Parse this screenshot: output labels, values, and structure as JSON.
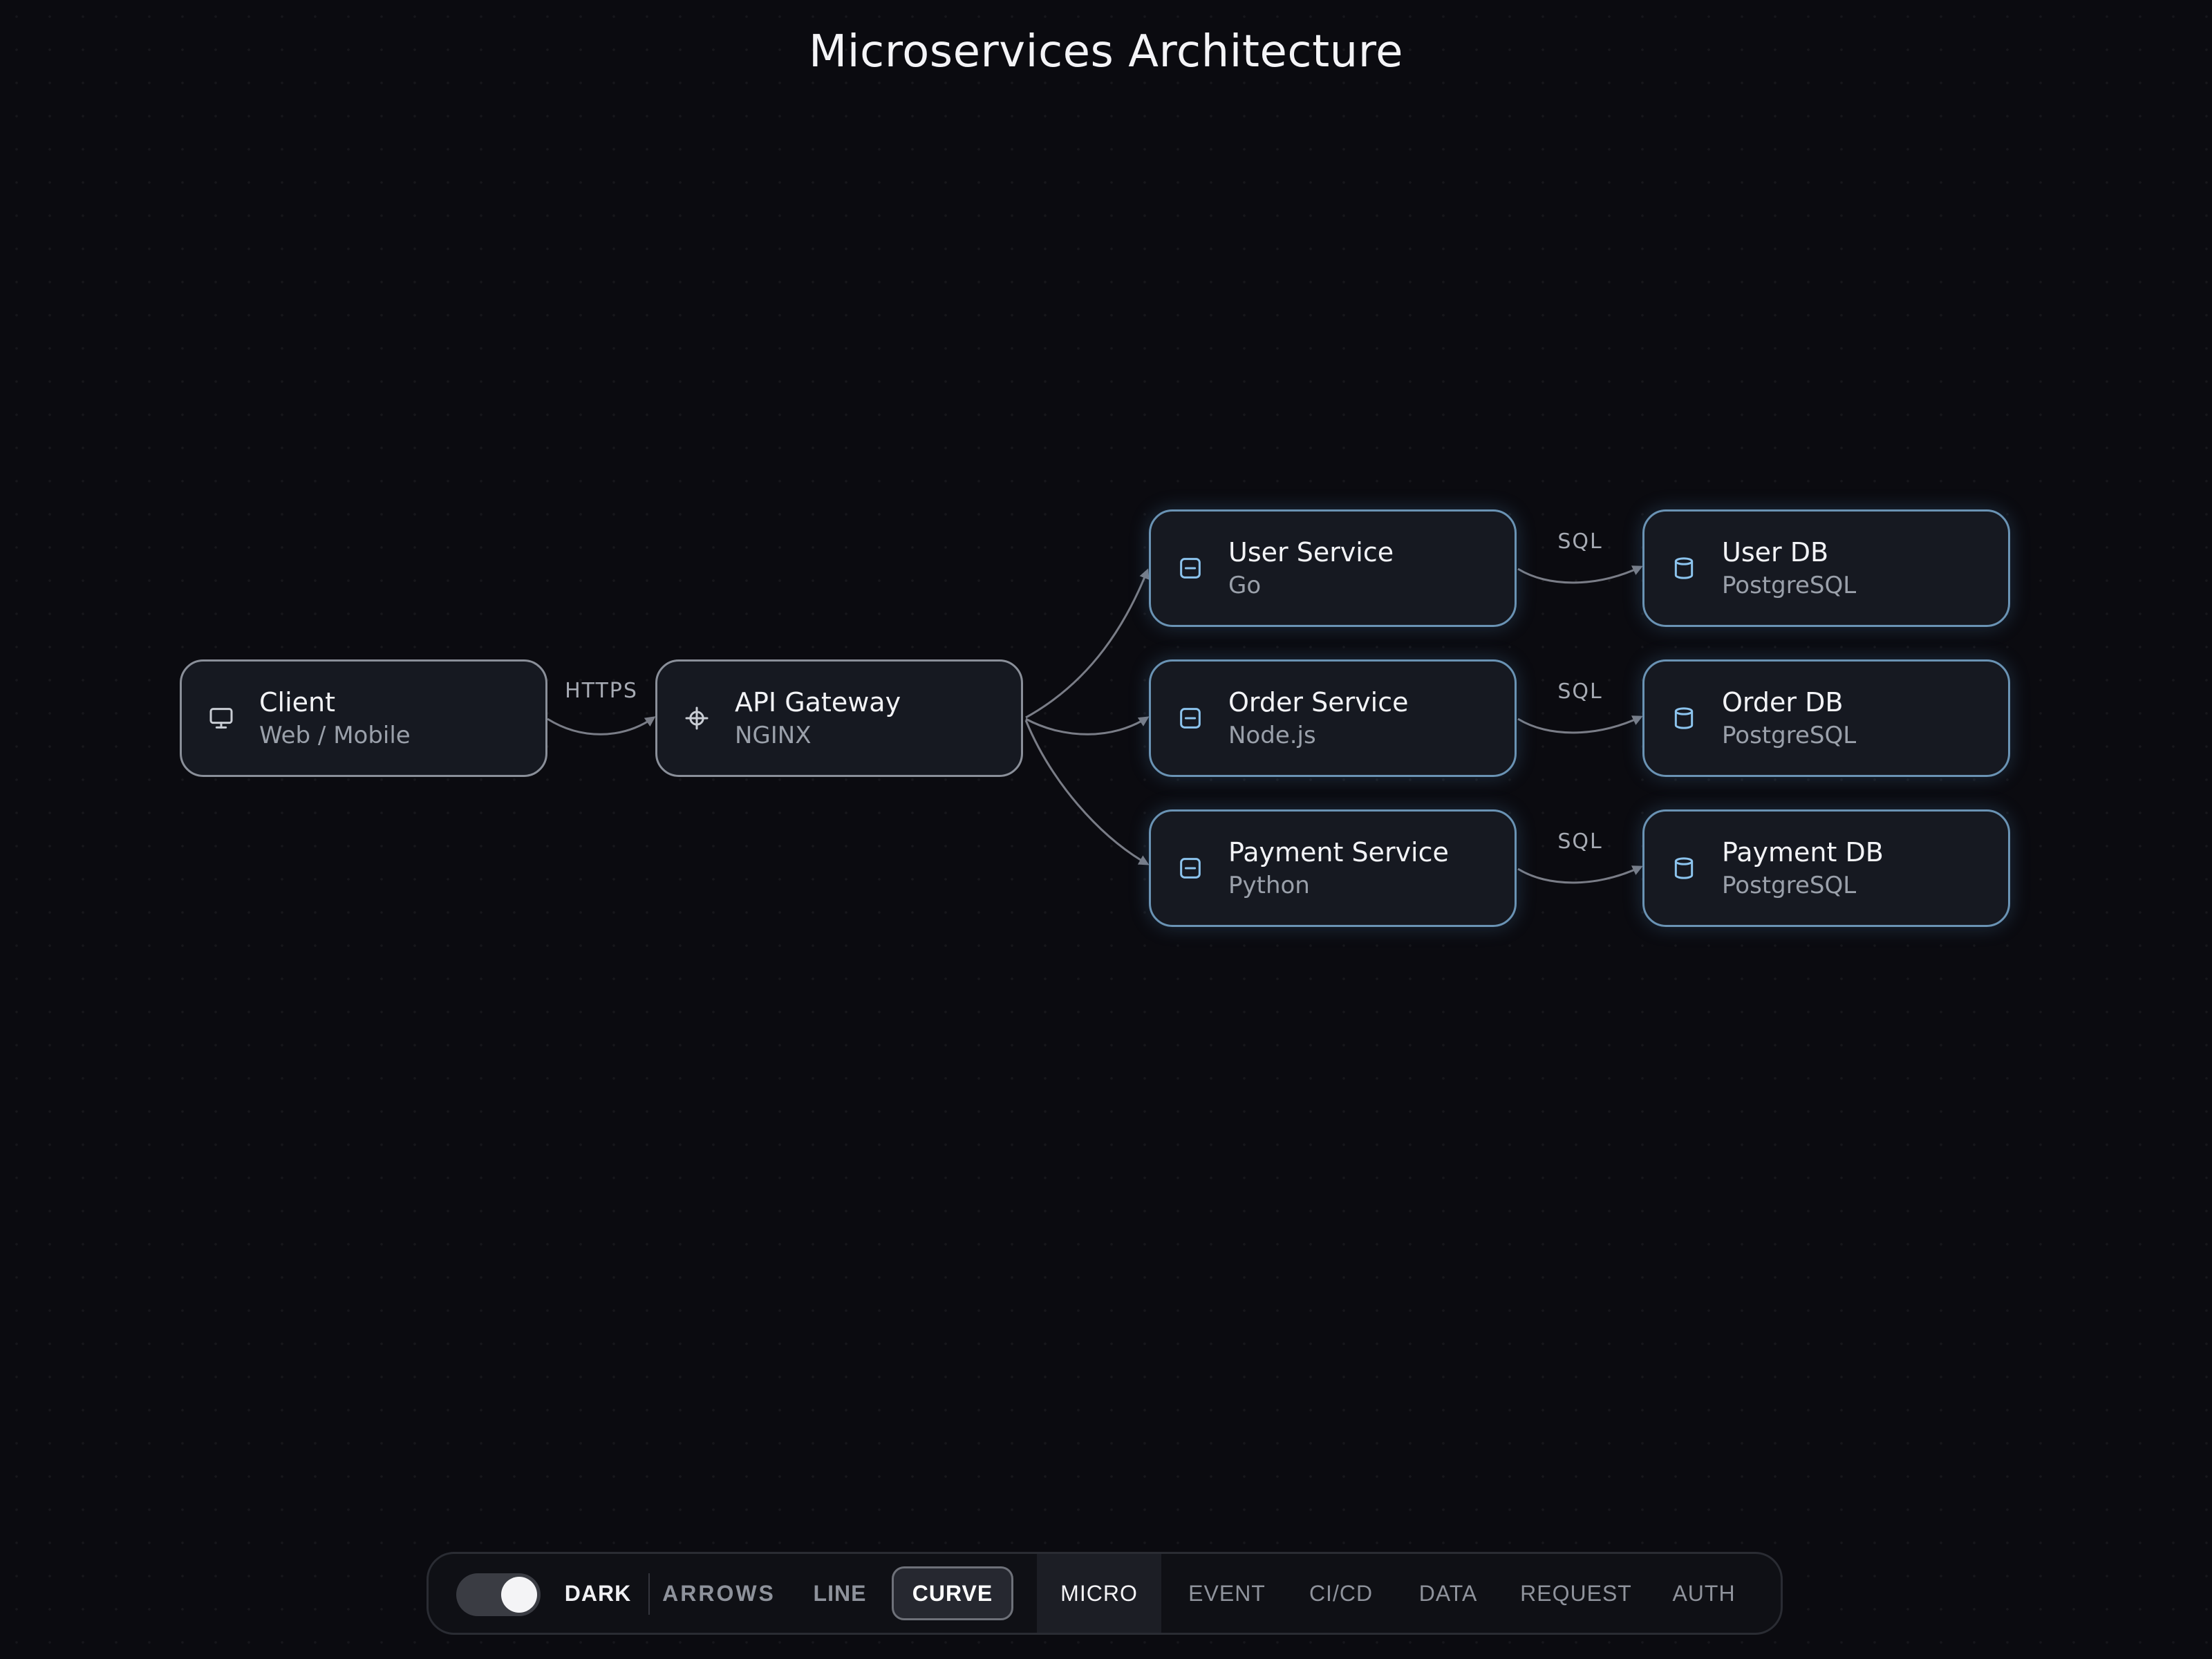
{
  "title": "Microservices Architecture",
  "colors": {
    "background": "#0b0b10",
    "node_fill": "#161921",
    "node_border_plain": "#8a8f99",
    "node_border_accent": "#6a93b4",
    "icon_accent": "#8cc4ee",
    "edge": "#8e929c"
  },
  "nodes": {
    "client": {
      "name": "Client",
      "sub": "Web / Mobile",
      "icon": "monitor-icon"
    },
    "gateway": {
      "name": "API Gateway",
      "sub": "NGINX",
      "icon": "crosshair-icon"
    },
    "user_service": {
      "name": "User Service",
      "sub": "Go",
      "icon": "service-box-icon"
    },
    "order_service": {
      "name": "Order Service",
      "sub": "Node.js",
      "icon": "service-box-icon"
    },
    "payment_service": {
      "name": "Payment Service",
      "sub": "Python",
      "icon": "service-box-icon"
    },
    "user_db": {
      "name": "User DB",
      "sub": "PostgreSQL",
      "icon": "database-icon"
    },
    "order_db": {
      "name": "Order DB",
      "sub": "PostgreSQL",
      "icon": "database-icon"
    },
    "payment_db": {
      "name": "Payment DB",
      "sub": "PostgreSQL",
      "icon": "database-icon"
    }
  },
  "edges": [
    {
      "from": "client",
      "to": "gateway",
      "label": "HTTPS"
    },
    {
      "from": "gateway",
      "to": "user_service",
      "label": ""
    },
    {
      "from": "gateway",
      "to": "order_service",
      "label": ""
    },
    {
      "from": "gateway",
      "to": "payment_service",
      "label": ""
    },
    {
      "from": "user_service",
      "to": "user_db",
      "label": "SQL"
    },
    {
      "from": "order_service",
      "to": "order_db",
      "label": "SQL"
    },
    {
      "from": "payment_service",
      "to": "payment_db",
      "label": "SQL"
    }
  ],
  "toolbar": {
    "theme_toggle_on": true,
    "theme_label": "DARK",
    "arrows_label": "ARROWS",
    "line_label": "LINE",
    "curve_label": "CURVE",
    "edge_style_selected": "CURVE",
    "presets": [
      "MICRO",
      "EVENT",
      "CI/CD",
      "DATA",
      "REQUEST",
      "AUTH"
    ],
    "preset_selected": "MICRO"
  }
}
